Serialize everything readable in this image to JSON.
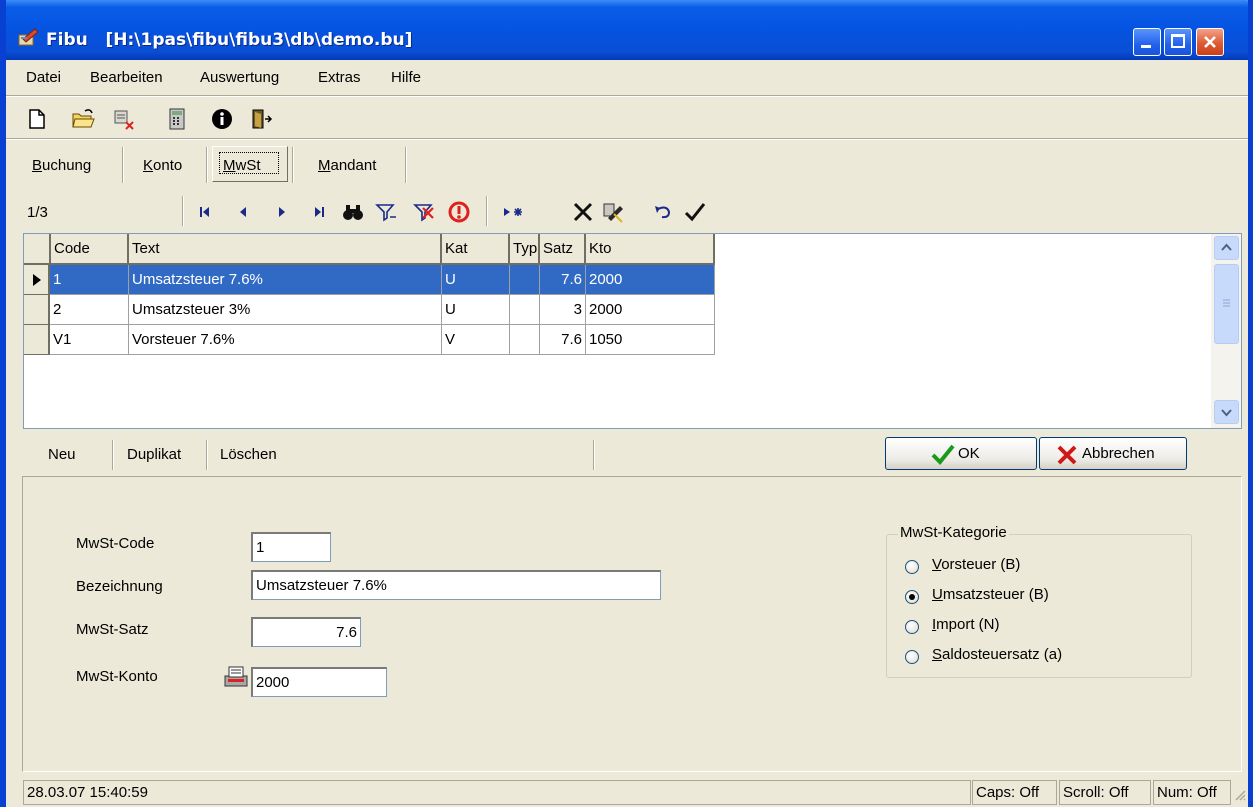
{
  "window": {
    "app_name": "Fibu",
    "path": "[H:\\1pas\\fibu\\fibu3\\db\\demo.bu]",
    "controls": [
      "minimize",
      "maximize",
      "close"
    ]
  },
  "menu": {
    "items": [
      {
        "label": "Datei"
      },
      {
        "label": "Bearbeiten"
      },
      {
        "label": "Auswertung"
      },
      {
        "label": "Extras"
      },
      {
        "label": "Hilfe"
      }
    ]
  },
  "toolbar": {
    "icons": [
      "new-document-icon",
      "open-folder-icon",
      "delete-icon",
      "calculator-icon",
      "info-icon",
      "exit-door-icon"
    ]
  },
  "tabs": {
    "items": [
      {
        "label": "Buchung",
        "accel": "B"
      },
      {
        "label": "Konto",
        "accel": "K"
      },
      {
        "label": "MwSt",
        "accel": "M",
        "active": true
      },
      {
        "label": "Mandant",
        "accel": "M"
      }
    ]
  },
  "navigator": {
    "record_position": "1/3",
    "icons": [
      "first-record-icon",
      "prior-record-icon",
      "next-record-icon",
      "last-record-icon",
      "find-icon",
      "filter-icon",
      "clear-filter-icon",
      "refresh-icon",
      "insert-record-icon",
      "delete-record-icon",
      "edit-icon",
      "undo-icon",
      "post-icon"
    ]
  },
  "grid": {
    "columns": [
      "Code",
      "Text",
      "Kat",
      "Typ",
      "Satz",
      "Kto"
    ],
    "rows": [
      {
        "code": "1",
        "text": "Umsatzsteuer 7.6%",
        "kat": "U",
        "typ": "",
        "satz": "7.6",
        "kto": "2000",
        "selected": true
      },
      {
        "code": "2",
        "text": "Umsatzsteuer 3%",
        "kat": "U",
        "typ": "",
        "satz": "3",
        "kto": "2000"
      },
      {
        "code": "V1",
        "text": "Vorsteuer 7.6%",
        "kat": "V",
        "typ": "",
        "satz": "7.6",
        "kto": "1050"
      }
    ]
  },
  "actions": {
    "neu": "Neu",
    "duplikat": "Duplikat",
    "loeschen": "Löschen",
    "ok": "OK",
    "abbrechen": "Abbrechen"
  },
  "form": {
    "mwst_code_label": "MwSt-Code",
    "mwst_code_value": "1",
    "bezeichnung_label": "Bezeichnung",
    "bezeichnung_value": "Umsatzsteuer 7.6%",
    "mwst_satz_label": "MwSt-Satz",
    "mwst_satz_value": "7.6",
    "mwst_konto_label": "MwSt-Konto",
    "mwst_konto_value": "2000",
    "kategorie": {
      "legend": "MwSt-Kategorie",
      "options": [
        {
          "label": "Vorsteuer (B)",
          "accel": "V",
          "checked": false
        },
        {
          "label": "Umsatzsteuer (B)",
          "accel": "U",
          "checked": true
        },
        {
          "label": "Import (N)",
          "accel": "I",
          "checked": false
        },
        {
          "label": "Saldosteuersatz (a)",
          "accel": "S",
          "checked": false
        }
      ]
    }
  },
  "statusbar": {
    "datetime": "28.03.07 15:40:59",
    "caps": "Caps: Off",
    "scroll": "Scroll: Off",
    "num": "Num: Off"
  },
  "colors": {
    "titlebar": "#0553E1",
    "selection": "#316AC5",
    "face": "#ECE9D8"
  }
}
